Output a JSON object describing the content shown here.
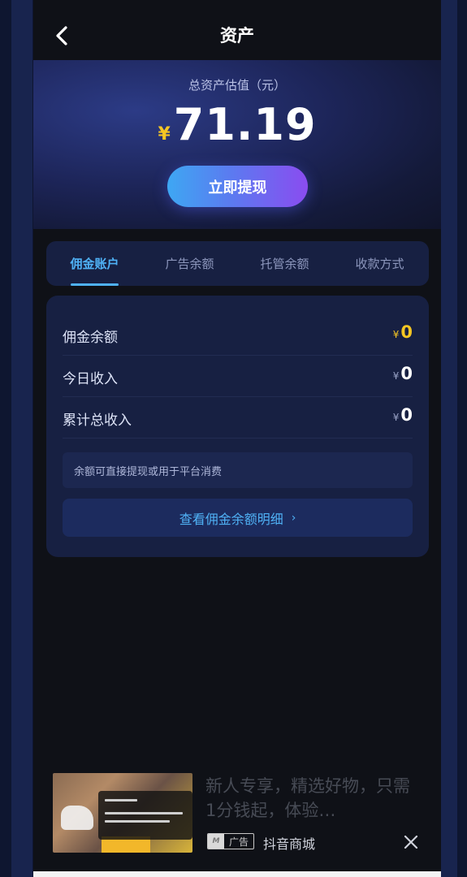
{
  "header": {
    "title": "资产"
  },
  "hero": {
    "label": "总资产估值（元）",
    "currency_symbol": "¥",
    "amount": "71.19",
    "withdraw_label": "立即提现"
  },
  "tabs": [
    {
      "label": "佣金账户",
      "active": true
    },
    {
      "label": "广告余额",
      "active": false
    },
    {
      "label": "托管余额",
      "active": false
    },
    {
      "label": "收款方式",
      "active": false
    }
  ],
  "commission": {
    "rows": [
      {
        "label": "佣金余额",
        "symbol": "¥",
        "value": "0"
      },
      {
        "label": "今日收入",
        "symbol": "¥",
        "value": "0"
      },
      {
        "label": "累计总收入",
        "symbol": "¥",
        "value": "0"
      }
    ],
    "note": "余额可直接提现或用于平台消费",
    "detail_label": "查看佣金余额明细",
    "detail_chevron": "›"
  },
  "ad": {
    "text": "新人专享，精选好物，只需1分钱起，体验…",
    "badge": "广告",
    "source": "抖音商城",
    "close_icon": "close-icon"
  },
  "colors": {
    "accent": "#4fb1f5",
    "gold": "#f5c623",
    "card_bg": "#172042",
    "page_bg": "#0f1117"
  }
}
